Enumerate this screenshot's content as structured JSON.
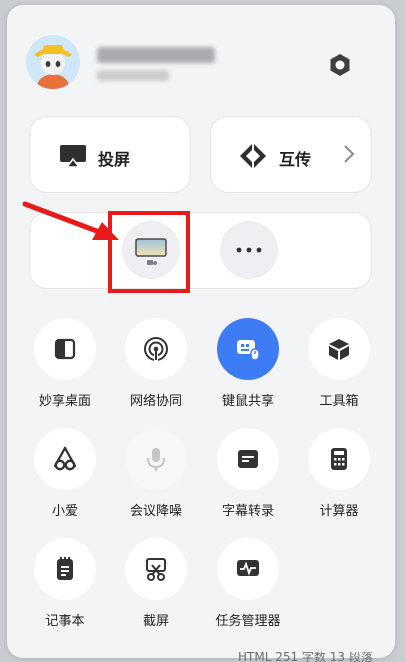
{
  "profile": {
    "avatar_icon": "avatar-icon"
  },
  "cards": {
    "screen_cast": "投屏",
    "mutual_transfer": "互传"
  },
  "quick_actions": [
    {
      "label": "妙享桌面",
      "icon": "desktop-share-icon",
      "state": "normal"
    },
    {
      "label": "网络协同",
      "icon": "network-sync-icon",
      "state": "normal"
    },
    {
      "label": "键鼠共享",
      "icon": "keyboard-mouse-icon",
      "state": "active"
    },
    {
      "label": "工具箱",
      "icon": "toolbox-icon",
      "state": "normal"
    },
    {
      "label": "小爱",
      "icon": "xiaoai-icon",
      "state": "normal"
    },
    {
      "label": "会议降噪",
      "icon": "microphone-icon",
      "state": "disabled"
    },
    {
      "label": "字幕转录",
      "icon": "subtitle-icon",
      "state": "normal"
    },
    {
      "label": "计算器",
      "icon": "calculator-icon",
      "state": "normal"
    },
    {
      "label": "记事本",
      "icon": "notepad-icon",
      "state": "normal"
    },
    {
      "label": "截屏",
      "icon": "screenshot-icon",
      "state": "normal"
    },
    {
      "label": "任务管理器",
      "icon": "task-manager-icon",
      "state": "normal"
    }
  ],
  "status_bar": {
    "text": "HTML  251 字数  13 段落"
  },
  "colors": {
    "accent": "#3d7cf4",
    "highlight": "#e81a1a",
    "panel": "#f3f4f6"
  }
}
